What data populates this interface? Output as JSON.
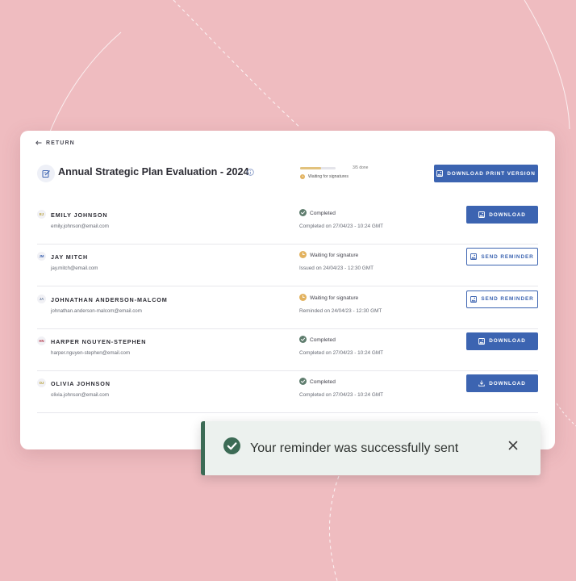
{
  "return_label": "RETURN",
  "document": {
    "title": "Annual Strategic Plan Evaluation - 2024",
    "progress_count": "3/5 done",
    "progress_fraction": 0.6,
    "progress_status": "Waiting for signatures",
    "print_button": "DOWNLOAD PRINT VERSION"
  },
  "signers": [
    {
      "initials": "EJ",
      "initials_color": "#b29a2c",
      "name": "EMILY JOHNSON",
      "email": "emily.johnson@email.com",
      "status": "Completed",
      "status_type": "completed",
      "detail": "Completed on 27/04/23 - 10:24 GMT",
      "action": "DOWNLOAD",
      "action_style": "primary",
      "action_icon": "image-icon"
    },
    {
      "initials": "JM",
      "initials_color": "#3c64b1",
      "name": "JAY MITCH",
      "email": "jay.mitch@email.com",
      "status": "Waiting for signature",
      "status_type": "waiting",
      "detail": "Issued on 24/04/23 - 12:30 GMT",
      "action": "SEND REMINDER",
      "action_style": "outline",
      "action_icon": "image-icon"
    },
    {
      "initials": "JA",
      "initials_color": "#6b7f9e",
      "name": "JOHNATHAN ANDERSON-MALCOM",
      "email": "johnathan.anderson-malcom@email.com",
      "status": "Waiting for signature",
      "status_type": "waiting",
      "detail": "Reminded on 24/04/23 - 12:30 GMT",
      "action": "SEND REMINDER",
      "action_style": "outline",
      "action_icon": "image-icon"
    },
    {
      "initials": "HN",
      "initials_color": "#b43a4c",
      "name": "HARPER NGUYEN-STEPHEN",
      "email": "harper.nguyen-stephen@email.com",
      "status": "Completed",
      "status_type": "completed",
      "detail": "Completed on 27/04/23 - 10:24 GMT",
      "action": "DOWNLOAD",
      "action_style": "primary",
      "action_icon": "image-icon"
    },
    {
      "initials": "OJ",
      "initials_color": "#b29a2c",
      "name": "OLIVIA JOHNSON",
      "email": "olivia.johnson@email.com",
      "status": "Completed",
      "status_type": "completed",
      "detail": "Completed on 27/04/23 - 10:24 GMT",
      "action": "DOWNLOAD",
      "action_style": "primary",
      "action_icon": "download-icon"
    }
  ],
  "toast": {
    "message": "Your reminder was successfully sent",
    "accent_color": "#3c6b55"
  },
  "colors": {
    "background": "#efbcc0",
    "primary": "#3c64b1",
    "completed": "#5f7d6e",
    "waiting": "#e2b25f"
  }
}
